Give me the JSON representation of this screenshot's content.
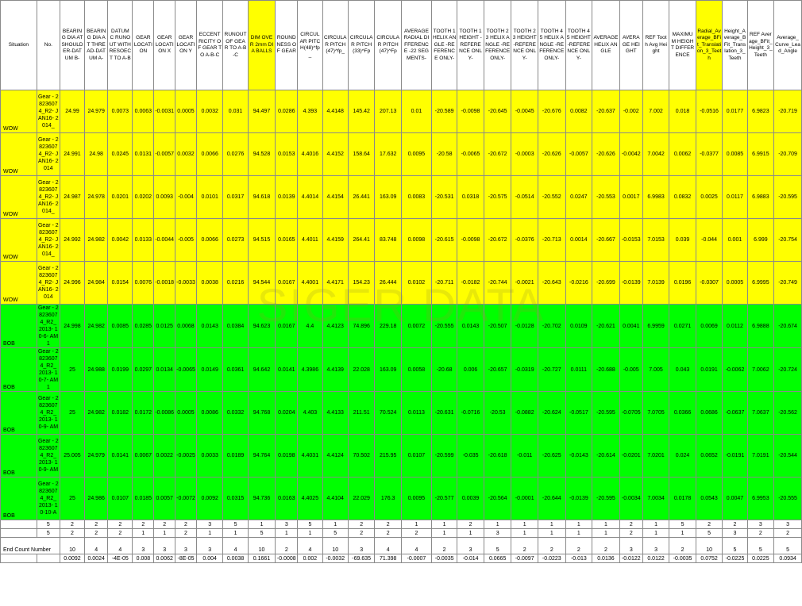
{
  "headers": [
    "Situation",
    "No.",
    "BEARING DIA AT SHOULDER-DATUM B-",
    "BEARING DIA AT THREAD-DATUM A-",
    "DATUM C RUNOUT WITH RESOECT TO A-B",
    "GEAR LOCATION",
    "GEAR LOCATION X",
    "GEAR LOCATION Y",
    "ECCENTRICITY OF GEAR TO A-B-C",
    "RUNOUT OF GEAR TO A-B-C",
    "DIM OVER 2mm DIA BALLS",
    "ROUNDNESS OF GEAR",
    "CIRCULAR PITCH(48)^fp_",
    "CIRCULAR PITCH(47)^fp_",
    "CIRCULAR PITCH(33)^Fp",
    "CIRCULAR PITCH(47)^Fp",
    "AVERAGE RADIAL DIFFERENCE -22 SEGMENTS-",
    "TOOTH 1 HELIX ANGLE -REFERENCE ONLY-",
    "TOOTH 1 HEIGHT -REFERENCE ONLY-",
    "TOOTH 23 HELIX ANGLE -REFERENCE ONLY-",
    "TOOTH 23 HEIGHT -REFERENCE ONLY-",
    "TOOTH 45 HELIX ANGLE -REFERENCE ONLY-",
    "TOOTH 45 HEIGHT -REFERENCE ONLY-",
    "AVERAGE HELIX ANGLE",
    "AVERAGE HEIGHT",
    "REF Tooth Avg Height",
    "MAXIMUM HEIGHT DIFFERENCE",
    "Radial_Average_BFit_Translation_3_Teeth",
    "Height_Average_BFit_Translation_3_Teeth",
    "REF Average_BFit_Height_3_Teeth",
    "Average_Curve_Lead_Angle"
  ],
  "highlight_columns": [
    10,
    27
  ],
  "rows": [
    {
      "sit": "WOW",
      "no": "Gear - 28236074_R2- JAN16- 2014_",
      "vals": [
        "24.99",
        "24.979",
        "0.0073",
        "0.0063",
        "-0.0031",
        "0.0005",
        "0.0032",
        "0.031",
        "94.497",
        "0.0286",
        "4.393",
        "4.4148",
        "145.42",
        "207.13",
        "0.01",
        "-20.589",
        "-0.0098",
        "-20.645",
        "-0.0045",
        "-20.676",
        "0.0082",
        "-20.637",
        "-0.002",
        "7.002",
        "0.018",
        "-0.0516",
        "0.0177",
        "6.9823",
        "-20.719"
      ]
    },
    {
      "sit": "WOW",
      "no": "Gear - 28236074_R2- JAN16- 2014",
      "vals": [
        "24.991",
        "24.98",
        "0.0245",
        "0.0131",
        "-0.0057",
        "0.0032",
        "0.0066",
        "0.0276",
        "94.528",
        "0.0153",
        "4.4016",
        "4.4152",
        "158.64",
        "17.632",
        "0.0095",
        "-20.58",
        "-0.0065",
        "-20.672",
        "-0.0003",
        "-20.626",
        "-0.0057",
        "-20.626",
        "-0.0042",
        "7.0042",
        "0.0062",
        "-0.0377",
        "0.0085",
        "6.9915",
        "-20.709"
      ]
    },
    {
      "sit": "WOW",
      "no": "Gear - 28236074_R2- JAN16- 2014_",
      "vals": [
        "24.987",
        "24.978",
        "0.0201",
        "0.0202",
        "0.0093",
        "-0.004",
        "0.0101",
        "0.0317",
        "94.618",
        "0.0139",
        "4.4014",
        "4.4154",
        "26.441",
        "163.09",
        "0.0083",
        "-20.531",
        "0.0318",
        "-20.575",
        "-0.0514",
        "-20.552",
        "0.0247",
        "-20.553",
        "0.0017",
        "6.9983",
        "0.0832",
        "0.0025",
        "0.0117",
        "6.9883",
        "-20.595"
      ]
    },
    {
      "sit": "WOW",
      "no": "Gear - 28236074_R2- JAN16- 2014_",
      "vals": [
        "24.992",
        "24.982",
        "0.0042",
        "0.0133",
        "-0.0044",
        "-0.005",
        "0.0066",
        "0.0273",
        "94.515",
        "0.0165",
        "4.4011",
        "4.4159",
        "264.41",
        "83.748",
        "0.0098",
        "-20.615",
        "-0.0098",
        "-20.672",
        "-0.0376",
        "-20.713",
        "0.0014",
        "-20.667",
        "-0.0153",
        "7.0153",
        "0.039",
        "-0.044",
        "0.001",
        "6.999",
        "-20.754"
      ]
    },
    {
      "sit": "WOW",
      "no": "Gear - 28236074_R2- JAN16- 2014",
      "vals": [
        "24.996",
        "24.984",
        "0.0154",
        "0.0076",
        "-0.0018",
        "-0.0033",
        "0.0038",
        "0.0216",
        "94.544",
        "0.0167",
        "4.4001",
        "4.4171",
        "154.23",
        "26.444",
        "0.0102",
        "-20.711",
        "-0.0182",
        "-20.744",
        "-0.0021",
        "-20.643",
        "-0.0216",
        "-20.699",
        "-0.0139",
        "7.0139",
        "0.0196",
        "-0.0307",
        "0.0005",
        "6.9995",
        "-20.749"
      ]
    },
    {
      "sit": "BOB",
      "no": "Gear - 28236074_R2_ 2013- 10-6- AM1",
      "vals": [
        "24.998",
        "24.982",
        "0.0085",
        "0.0285",
        "0.0125",
        "0.0068",
        "0.0143",
        "0.0384",
        "94.623",
        "0.0167",
        "4.4",
        "4.4123",
        "74.896",
        "229.18",
        "0.0072",
        "-20.555",
        "0.0143",
        "-20.507",
        "-0.0128",
        "-20.702",
        "0.0109",
        "-20.621",
        "0.0041",
        "6.9959",
        "0.0271",
        "0.0069",
        "0.0112",
        "6.9888",
        "-20.674"
      ]
    },
    {
      "sit": "BOB",
      "no": "Gear - 28236074_R2_ 2013- 10-7- AM1",
      "vals": [
        "25",
        "24.988",
        "0.0199",
        "0.0297",
        "0.0134",
        "-0.0065",
        "0.0149",
        "0.0361",
        "94.642",
        "0.0141",
        "4.3986",
        "4.4139",
        "22.028",
        "163.09",
        "0.0058",
        "-20.68",
        "0.006",
        "-20.657",
        "-0.0319",
        "-20.727",
        "0.0111",
        "-20.688",
        "-0.005",
        "7.005",
        "0.043",
        "0.0191",
        "-0.0062",
        "7.0062",
        "-20.724"
      ]
    },
    {
      "sit": "BOB",
      "no": "Gear - 28236074_R2_ 2013- 10-9- AM",
      "vals": [
        "25",
        "24.982",
        "0.0182",
        "0.0172",
        "-0.0086",
        "0.0005",
        "0.0086",
        "0.0332",
        "94.768",
        "0.0204",
        "4.403",
        "4.4133",
        "211.51",
        "70.524",
        "0.0113",
        "-20.631",
        "-0.0716",
        "-20.53",
        "-0.0882",
        "-20.624",
        "-0.0517",
        "-20.595",
        "-0.0705",
        "7.0705",
        "0.0366",
        "0.0686",
        "-0.0637",
        "7.0637",
        "-20.562"
      ]
    },
    {
      "sit": "BOB",
      "no": "Gear - 28236074_R2_ 2013- 10-9- AM",
      "vals": [
        "25.005",
        "24.979",
        "0.0141",
        "0.0067",
        "0.0022",
        "-0.0025",
        "0.0033",
        "0.0189",
        "94.764",
        "0.0198",
        "4.4031",
        "4.4124",
        "70.502",
        "215.95",
        "0.0107",
        "-20.599",
        "-0.035",
        "-20.618",
        "-0.011",
        "-20.625",
        "-0.0143",
        "-20.614",
        "-0.0201",
        "7.0201",
        "0.024",
        "0.0652",
        "-0.0191",
        "7.0191",
        "-20.544"
      ]
    },
    {
      "sit": "BOB",
      "no": "Gear - 28236074_R2_ 2013- 10-10-A",
      "vals": [
        "25",
        "24.986",
        "0.0107",
        "0.0185",
        "0.0057",
        "-0.0072",
        "0.0092",
        "0.0315",
        "94.736",
        "0.0163",
        "4.4025",
        "4.4104",
        "22.029",
        "176.3",
        "0.0095",
        "-20.577",
        "0.0039",
        "-20.564",
        "-0.0001",
        "-20.644",
        "-0.0139",
        "-20.595",
        "-0.0034",
        "7.0034",
        "0.0178",
        "0.0543",
        "0.0047",
        "6.9953",
        "-20.555"
      ]
    }
  ],
  "footer1": [
    "5",
    "2",
    "2",
    "2",
    "2",
    "2",
    "2",
    "3",
    "5",
    "1",
    "3",
    "5",
    "1",
    "2",
    "2",
    "1",
    "1",
    "2",
    "1",
    "1",
    "1",
    "1",
    "1",
    "2",
    "1",
    "5",
    "2",
    "2",
    "3",
    "3"
  ],
  "footer2": [
    "5",
    "2",
    "2",
    "2",
    "1",
    "1",
    "2",
    "1",
    "1",
    "5",
    "1",
    "1",
    "5",
    "2",
    "2",
    "2",
    "1",
    "1",
    "3",
    "1",
    "1",
    "1",
    "1",
    "2",
    "1",
    "1",
    "5",
    "3",
    "2",
    "2"
  ],
  "footer3_label": "End Count Number",
  "footer3": [
    "10",
    "4",
    "4",
    "3",
    "3",
    "3",
    "3",
    "4",
    "10",
    "2",
    "4",
    "10",
    "3",
    "4",
    "4",
    "2",
    "3",
    "5",
    "2",
    "2",
    "2",
    "2",
    "3",
    "3",
    "2",
    "10",
    "5",
    "5",
    "5"
  ],
  "footer4": [
    "0.0092",
    "0.0024",
    "-4E-05",
    "0.008",
    "0.0062",
    "-8E-05",
    "0.004",
    "0.0038",
    "0.1661",
    "-0.0008",
    "0.002",
    "-0.0032",
    "-69.635",
    "71.398",
    "-0.0007",
    "-0.0035",
    "-0.014",
    "0.0665",
    "-0.0097",
    "-0.0223",
    "-0.013",
    "0.0136",
    "-0.0122",
    "0.0122",
    "-0.0035",
    "0.0752",
    "-0.0225",
    "0.0225",
    "0.0934"
  ],
  "watermark": "SIGER DATA"
}
